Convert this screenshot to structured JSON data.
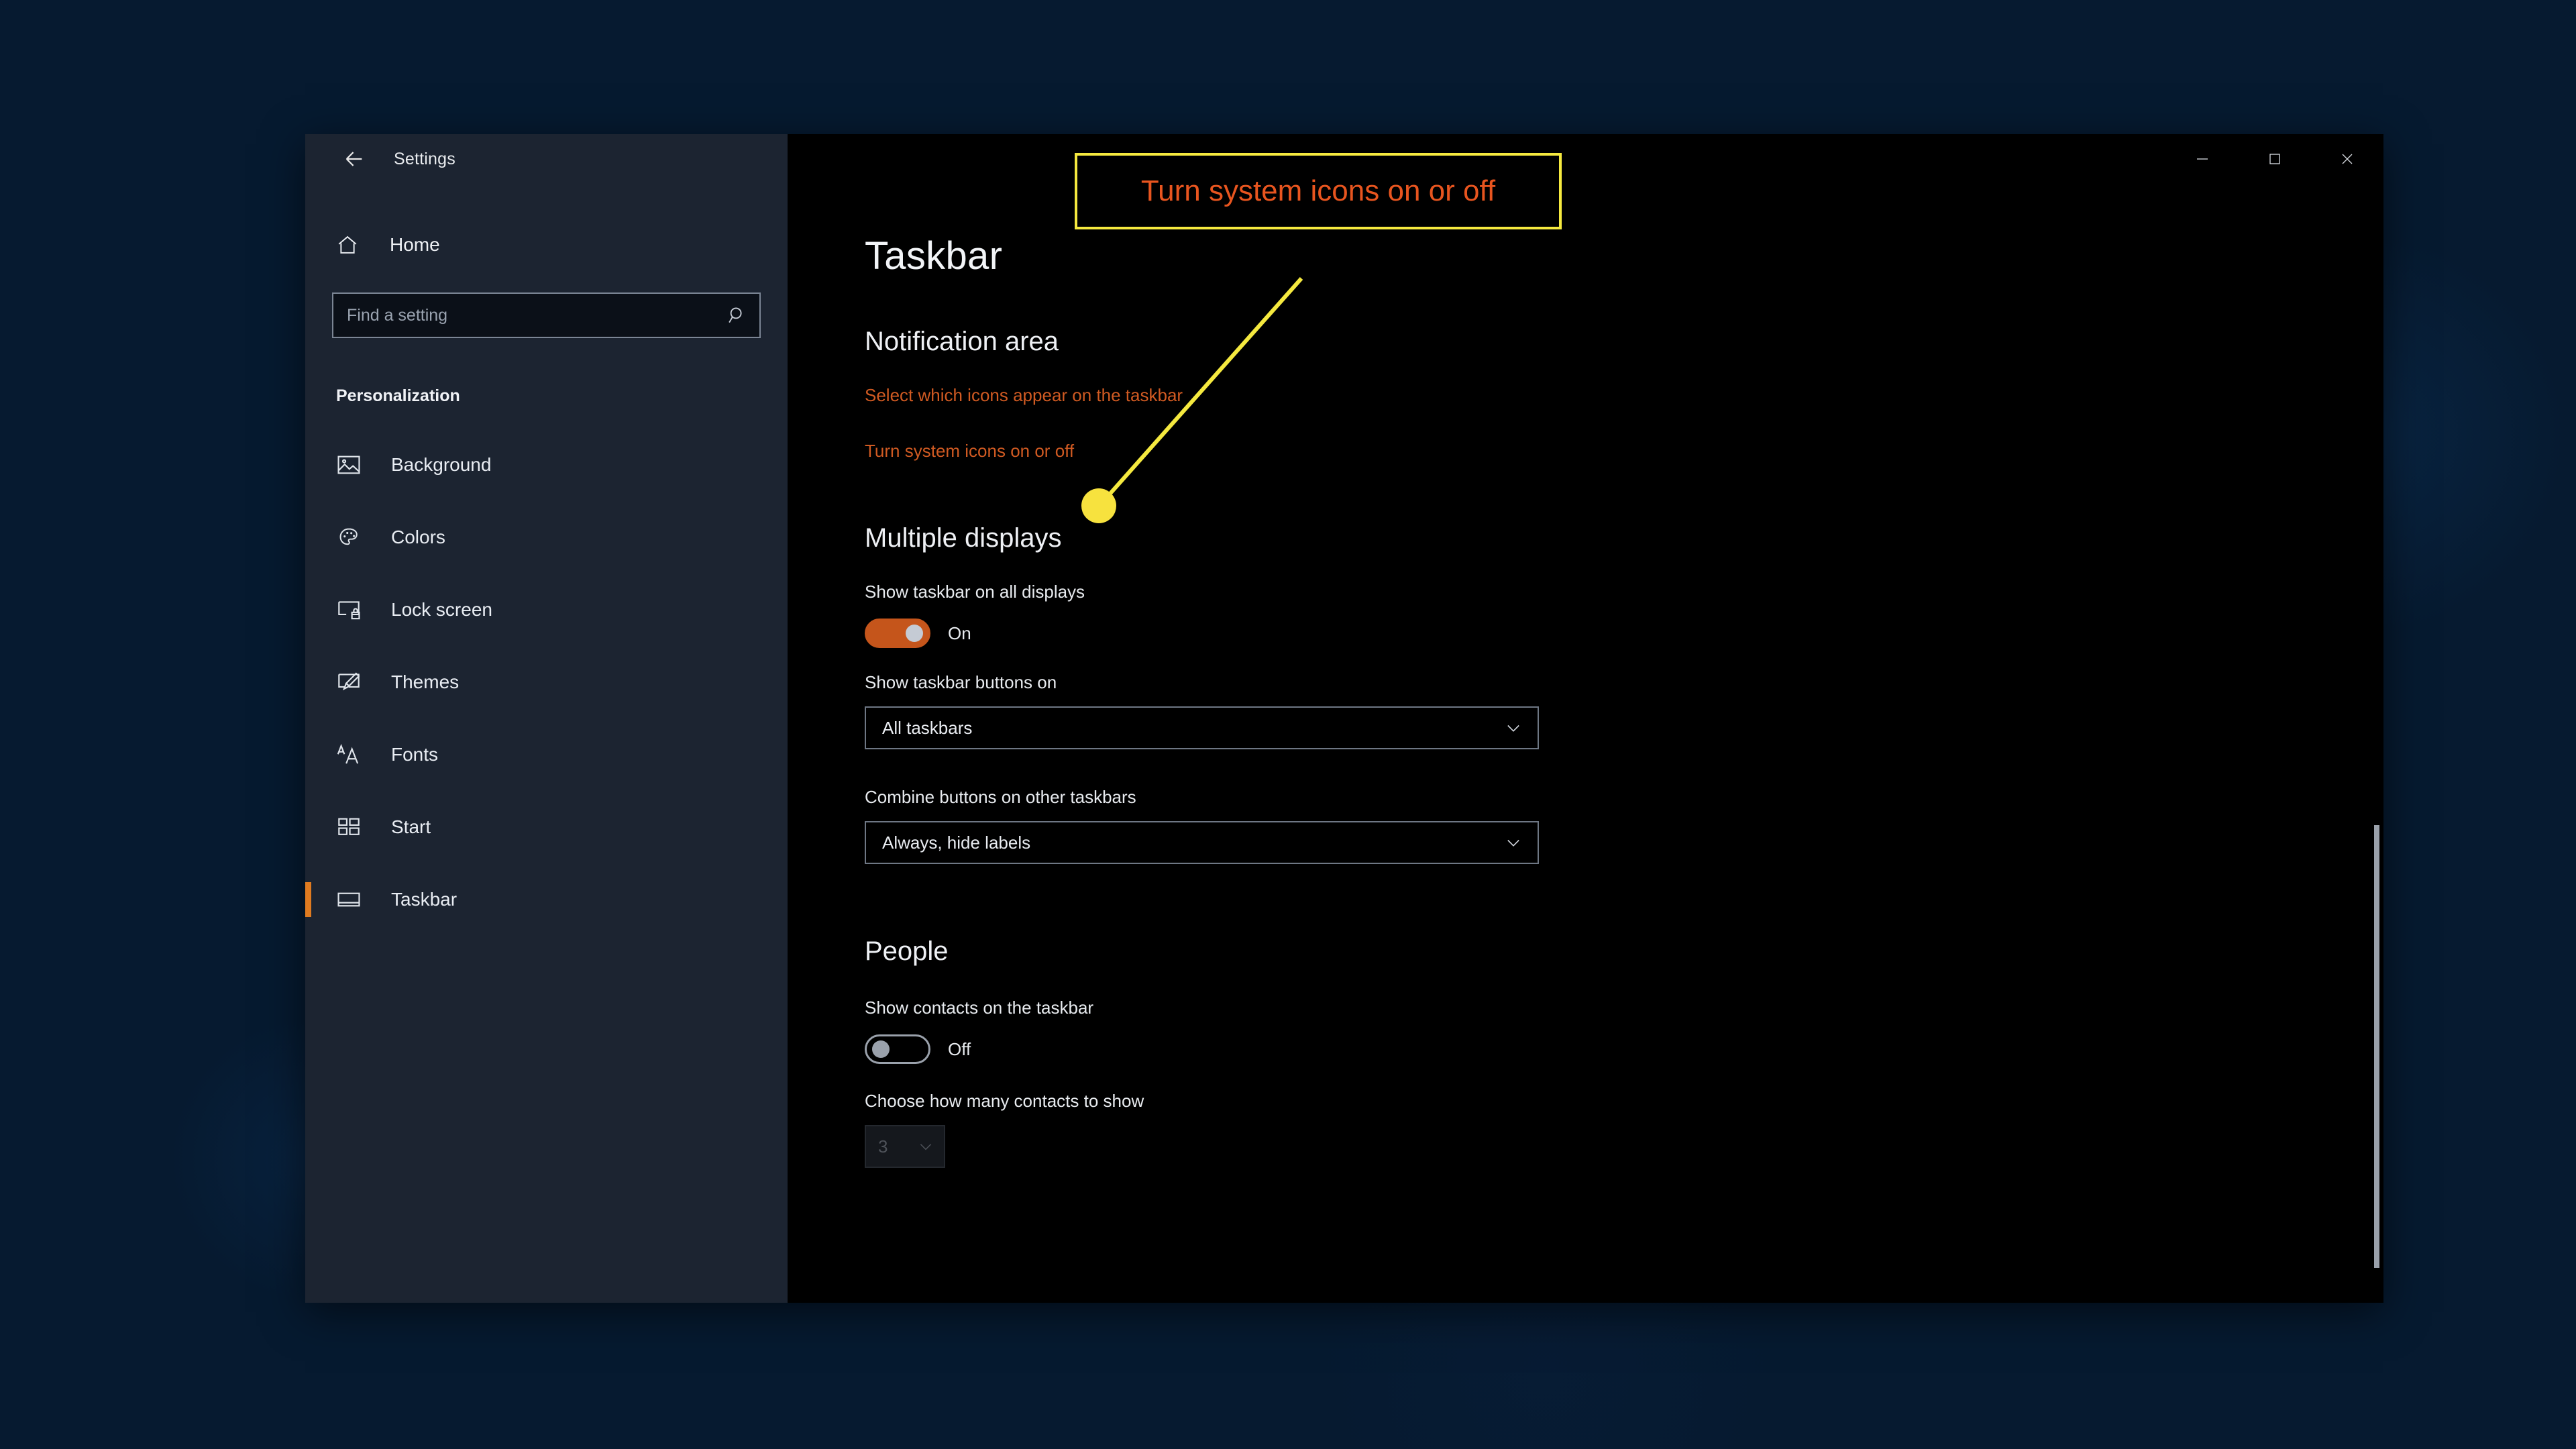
{
  "window": {
    "app_title": "Settings",
    "back_icon": "back-arrow-icon",
    "controls": {
      "minimize": "minimize-icon",
      "maximize": "maximize-icon",
      "close": "close-icon"
    }
  },
  "sidebar": {
    "home_label": "Home",
    "home_icon": "home-icon",
    "search": {
      "placeholder": "Find a setting",
      "value": "",
      "icon": "search-icon"
    },
    "section_header": "Personalization",
    "items": [
      {
        "label": "Background",
        "icon": "image-icon",
        "selected": false
      },
      {
        "label": "Colors",
        "icon": "palette-icon",
        "selected": false
      },
      {
        "label": "Lock screen",
        "icon": "lock-screen-icon",
        "selected": false
      },
      {
        "label": "Themes",
        "icon": "brush-icon",
        "selected": false
      },
      {
        "label": "Fonts",
        "icon": "fonts-icon",
        "selected": false
      },
      {
        "label": "Start",
        "icon": "start-tiles-icon",
        "selected": false
      },
      {
        "label": "Taskbar",
        "icon": "taskbar-icon",
        "selected": true
      }
    ]
  },
  "main": {
    "page_title": "Taskbar",
    "notification_area": {
      "heading": "Notification area",
      "links": [
        "Select which icons appear on the taskbar",
        "Turn system icons on or off"
      ]
    },
    "multiple_displays": {
      "heading": "Multiple displays",
      "show_taskbar_all_label": "Show taskbar on all displays",
      "show_taskbar_all_state": "On",
      "show_taskbar_buttons_label": "Show taskbar buttons on",
      "show_taskbar_buttons_value": "All taskbars",
      "combine_buttons_label": "Combine buttons on other taskbars",
      "combine_buttons_value": "Always, hide labels"
    },
    "people": {
      "heading": "People",
      "show_contacts_label": "Show contacts on the taskbar",
      "show_contacts_state": "Off",
      "choose_count_label": "Choose how many contacts to show",
      "choose_count_value": "3"
    }
  },
  "annotation": {
    "callout_text": "Turn system icons on or off",
    "box_color": "#f5e93f",
    "text_color": "#e8551f",
    "pointer_color": "#f7e23e"
  },
  "colors": {
    "accent_orange": "#c5551b",
    "sidebar_bg": "#1c2431",
    "content_bg": "#000000",
    "link_orange": "#d05a22"
  }
}
